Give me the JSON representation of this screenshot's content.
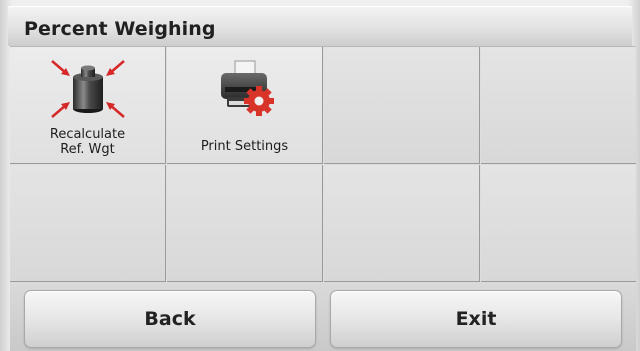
{
  "header": {
    "title": "Percent Weighing"
  },
  "menu": {
    "items": [
      {
        "label_line1": "Recalculate",
        "label_line2": "Ref. Wgt",
        "icon": "recalculate-reference-weight-icon"
      },
      {
        "label": "Print Settings",
        "icon": "printer-settings-icon"
      }
    ]
  },
  "footer": {
    "back_label": "Back",
    "exit_label": "Exit"
  },
  "colors": {
    "arrow_red": "#d62828",
    "gear_red": "#d8342a"
  }
}
